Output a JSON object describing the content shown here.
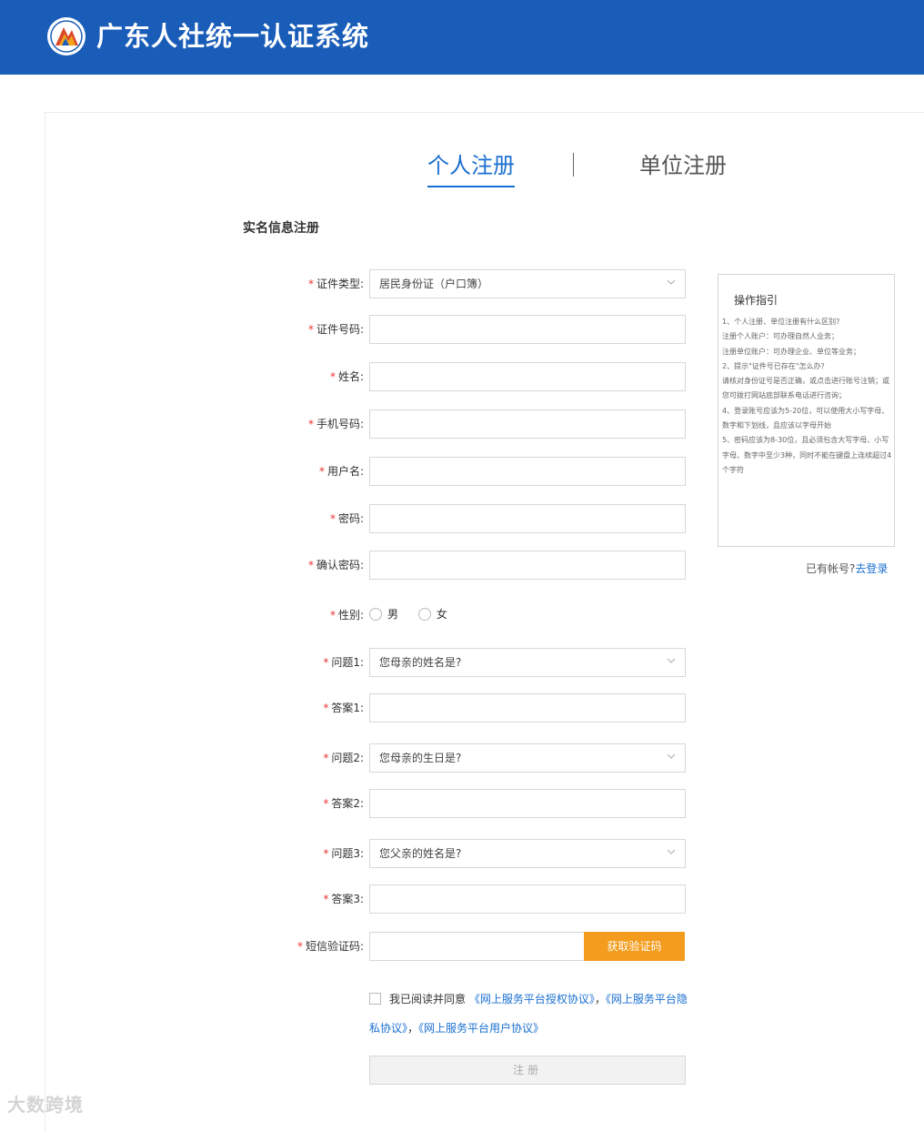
{
  "header": {
    "title": "广东人社统一认证系统",
    "logo_icon": "emblem-logo-icon"
  },
  "tabs": {
    "personal": "个人注册",
    "company": "单位注册"
  },
  "section_title": "实名信息注册",
  "form": {
    "id_type": {
      "label": "证件类型:",
      "value": "居民身份证（户口簿）"
    },
    "id_number": {
      "label": "证件号码:",
      "value": ""
    },
    "name": {
      "label": "姓名:",
      "value": ""
    },
    "phone": {
      "label": "手机号码:",
      "value": ""
    },
    "username": {
      "label": "用户名:",
      "value": ""
    },
    "password": {
      "label": "密码:",
      "value": ""
    },
    "confirm_password": {
      "label": "确认密码:",
      "value": ""
    },
    "gender": {
      "label": "性别:",
      "options": [
        "男",
        "女"
      ]
    },
    "question1": {
      "label": "问题1:",
      "value": "您母亲的姓名是?"
    },
    "answer1": {
      "label": "答案1:",
      "value": ""
    },
    "question2": {
      "label": "问题2:",
      "value": "您母亲的生日是?"
    },
    "answer2": {
      "label": "答案2:",
      "value": ""
    },
    "question3": {
      "label": "问题3:",
      "value": "您父亲的姓名是?"
    },
    "answer3": {
      "label": "答案3:",
      "value": ""
    },
    "sms": {
      "label": "短信验证码:",
      "value": "",
      "button": "获取验证码"
    }
  },
  "agreement": {
    "text": "我已阅读并同意",
    "link1": "《网上服务平台授权协议》",
    "sep1": "，",
    "link2": "《网上服务平台隐私协议》",
    "sep2": "，",
    "link3": "《网上服务平台用户协议》"
  },
  "submit_label": "注册",
  "guide": {
    "title": "操作指引",
    "lines": [
      "1、个人注册、单位注册有什么区别?",
      "注册个人账户：可办理自然人业务；",
      "注册单位账户：可办理企业、单位等业务；",
      "2、提示\"证件号已存在\"怎么办?",
      "请核对身份证号是否正确，或点击进行账号注销；或您可拨打网站底部联系电话进行咨询；",
      "4、登录账号应该为5-20位，可以使用大小写字母、数字和下划线，且应该以字母开始",
      "5、密码应该为8-30位，且必须包含大写字母、小写字母、数字中至少3种，同时不能在键盘上连续超过4个字符"
    ]
  },
  "login_prompt": {
    "text": "已有帐号?",
    "link": "去登录"
  },
  "watermark": "大数跨境",
  "colors": {
    "header": "#1a5db8",
    "accent": "#1a6fd0",
    "button": "#f39c1d",
    "required": "#e33333"
  }
}
